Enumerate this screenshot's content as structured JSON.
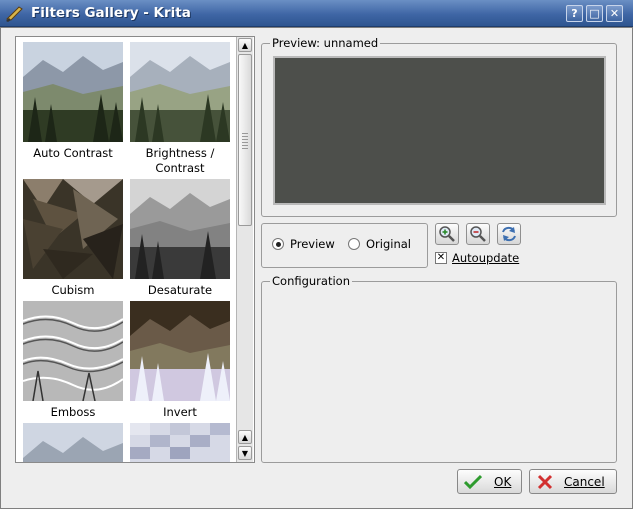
{
  "window": {
    "title": "Filters Gallery - Krita",
    "help_label": "?",
    "maximize_label": "□",
    "close_label": "✕"
  },
  "gallery": {
    "items": [
      {
        "label": "Auto Contrast",
        "thumb": "landscape"
      },
      {
        "label": "Brightness / Contrast",
        "thumb": "landscape-light"
      },
      {
        "label": "Cubism",
        "thumb": "cubism"
      },
      {
        "label": "Desaturate",
        "thumb": "grayscale"
      },
      {
        "label": "Emboss",
        "thumb": "emboss"
      },
      {
        "label": "Invert",
        "thumb": "invert"
      },
      {
        "label": "",
        "thumb": "landscape-partial"
      },
      {
        "label": "",
        "thumb": "pixelize-partial"
      }
    ]
  },
  "preview": {
    "group_title": "Preview: unnamed",
    "mode_preview": "Preview",
    "mode_original": "Original",
    "selected_mode": "Preview",
    "autoupdate_label": "Autoupdate",
    "autoupdate_checked": true
  },
  "configuration": {
    "group_title": "Configuration"
  },
  "buttons": {
    "ok": "OK",
    "cancel": "Cancel"
  }
}
